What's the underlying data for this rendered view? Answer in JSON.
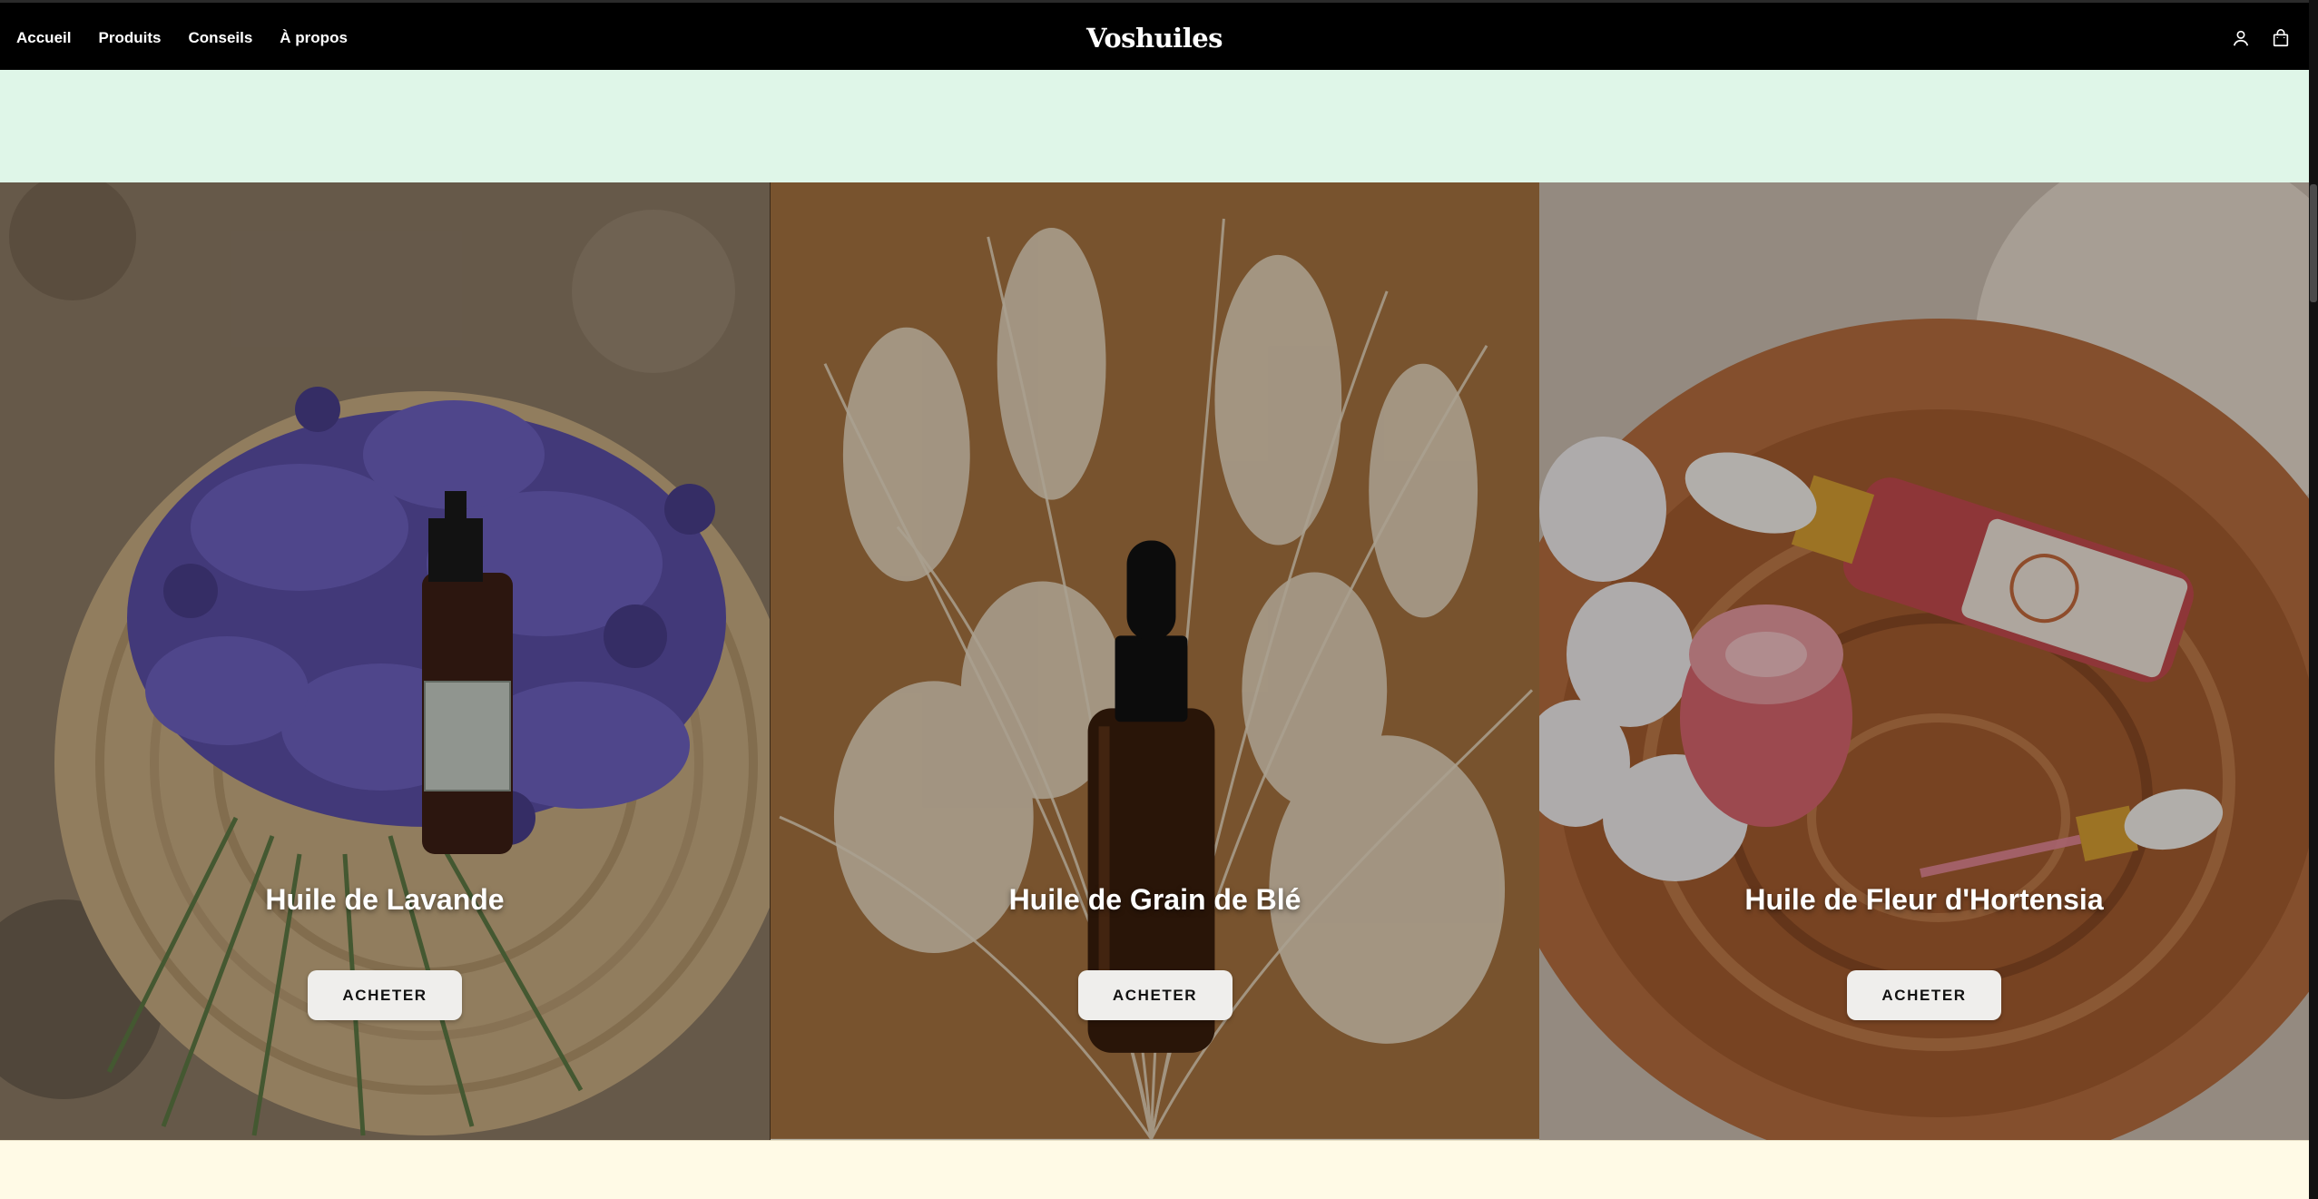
{
  "nav": {
    "links": [
      "Accueil",
      "Produits",
      "Conseils",
      "À propos"
    ],
    "brand": "Voshuiles",
    "icons": [
      "user-icon",
      "shopping-bag-icon"
    ]
  },
  "products": [
    {
      "title": "Huile de Lavande",
      "button": "ACHETER",
      "image": "lavender-bottle-photo"
    },
    {
      "title": "Huile de Grain de Blé",
      "button": "ACHETER",
      "image": "wheat-grass-bottle-photo"
    },
    {
      "title": "Huile de Fleur d'Hortensia",
      "button": "ACHETER",
      "image": "hydrangea-serum-photo"
    }
  ],
  "colors": {
    "navbar": "#000000",
    "mint_band": "#dff6e8",
    "cream_band": "#fffae6",
    "button": "#efeeec"
  }
}
